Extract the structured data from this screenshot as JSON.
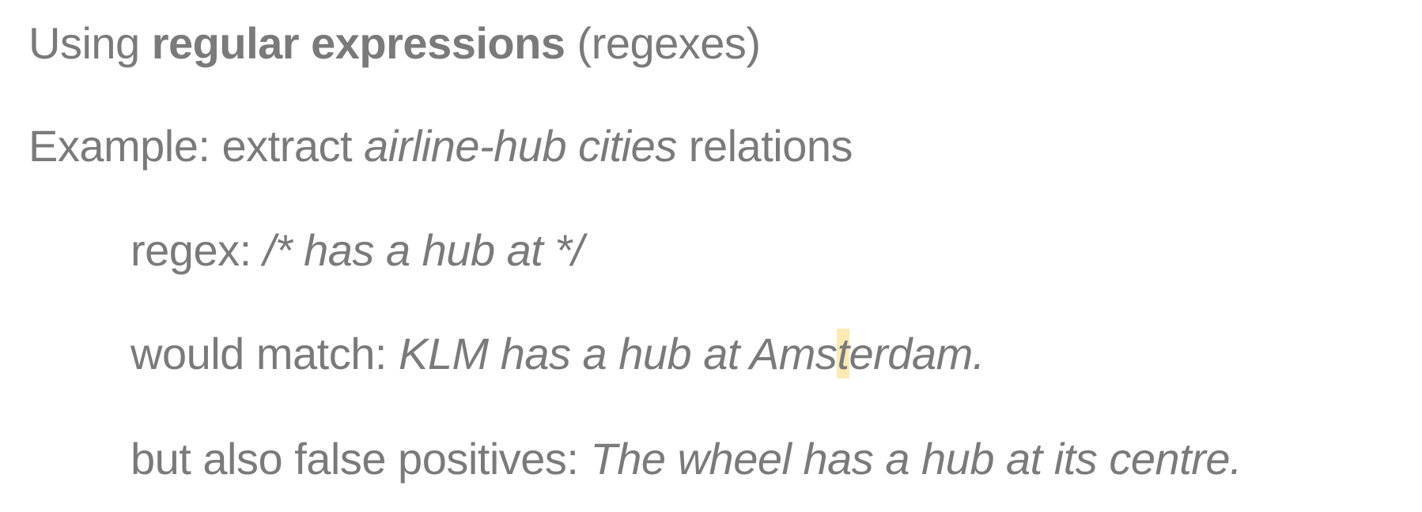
{
  "line1": {
    "prefix": "Using ",
    "bold": "regular expressions",
    "suffix": " (regexes)"
  },
  "line2": {
    "prefix": "Example: extract ",
    "italic": "airline-hub cities",
    "suffix": " relations"
  },
  "line3": {
    "label": "regex: ",
    "pattern": "/* has a hub at */"
  },
  "line4": {
    "label": "would match: ",
    "example_before": "KLM has a hub at Ams",
    "example_highlight": "t",
    "example_after": "erdam."
  },
  "line5": {
    "label": "but also false positives: ",
    "example": "The wheel has a hub at its centre."
  },
  "colors": {
    "text": "#7a7a7a",
    "highlight": "#fde9b3"
  }
}
